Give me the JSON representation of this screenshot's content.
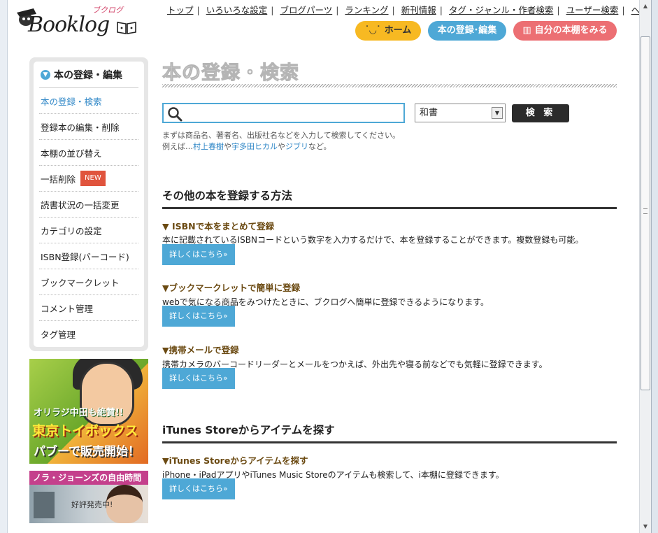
{
  "logo": {
    "text": "Booklog",
    "kana": "ブクログ"
  },
  "topnav": [
    "トップ",
    "いろいろな設定",
    "ブログパーツ",
    "ランキング",
    "新刊情報",
    "タグ・ジャンル・作者検索",
    "ユーザー検索",
    "ヘルプ"
  ],
  "buttons": {
    "home": "ホーム",
    "register": "本の登録･編集",
    "shelf": "自分の本棚をみる"
  },
  "sidebar": {
    "title": "本の登録・編集",
    "items": [
      {
        "label": "本の登録・検索",
        "active": true
      },
      {
        "label": "登録本の編集・削除"
      },
      {
        "label": "本棚の並び替え"
      },
      {
        "label": "一括削除",
        "badge": "NEW"
      },
      {
        "label": "読書状況の一括変更"
      },
      {
        "label": "カテゴリの設定"
      },
      {
        "label": "ISBN登録(バーコード)"
      },
      {
        "label": "ブックマークレット"
      },
      {
        "label": "コメント管理"
      },
      {
        "label": "タグ管理"
      }
    ]
  },
  "ads": {
    "ad1": {
      "line1": "オリラジ中田も絶賛!!",
      "line2": "東京トイボックス",
      "line3": "パブーで販売開始！"
    },
    "ad2": {
      "line1": "ノラ・ジョーンズの自由時間",
      "line2": "好評発売中!"
    }
  },
  "page_title": "本の登録・検索",
  "search": {
    "value": "",
    "select_value": "和書",
    "button": "検 索",
    "hint_line1": "まずは商品名、著者名、出版社名などを入力して検索してください。",
    "hint_prefix": "例えば…",
    "hint_ex1": "村上春樹",
    "hint_ya1": "や",
    "hint_ex2": "宇多田ヒカル",
    "hint_ya2": "や",
    "hint_ex3": "ジブリ",
    "hint_suffix": "など。"
  },
  "other_section": {
    "title": "その他の本を登録する方法",
    "blocks": [
      {
        "heading": "▼ ISBNで本をまとめて登録",
        "desc": "本に記載されているISBNコードという数字を入力するだけで、本を登録することができます。複数登録も可能。",
        "link": "詳しくはこちら»"
      },
      {
        "heading": "▼ブックマークレットで簡単に登録",
        "desc": "webで気になる商品をみつけたときに、ブクログへ簡単に登録できるようになります。",
        "link": "詳しくはこちら»"
      },
      {
        "heading": "▼携帯メールで登録",
        "desc": "携帯カメラのバーコードリーダーとメールをつかえば、外出先や寝る前などでも気軽に登録できます。",
        "link": "詳しくはこちら»"
      }
    ]
  },
  "itunes_section": {
    "title": "iTunes Storeからアイテムを探す",
    "heading": "▼iTunes Storeからアイテムを探す",
    "desc": "iPhone・iPadアプリやiTunes Music Storeのアイテムも検索して、i本棚に登録できます。",
    "link": "詳しくはこちら»"
  },
  "colors": {
    "accent": "#4ea8d6",
    "home": "#f7b922",
    "shelf": "#ec6f73",
    "badge": "#e0543d",
    "subheading": "#6b4a12"
  }
}
